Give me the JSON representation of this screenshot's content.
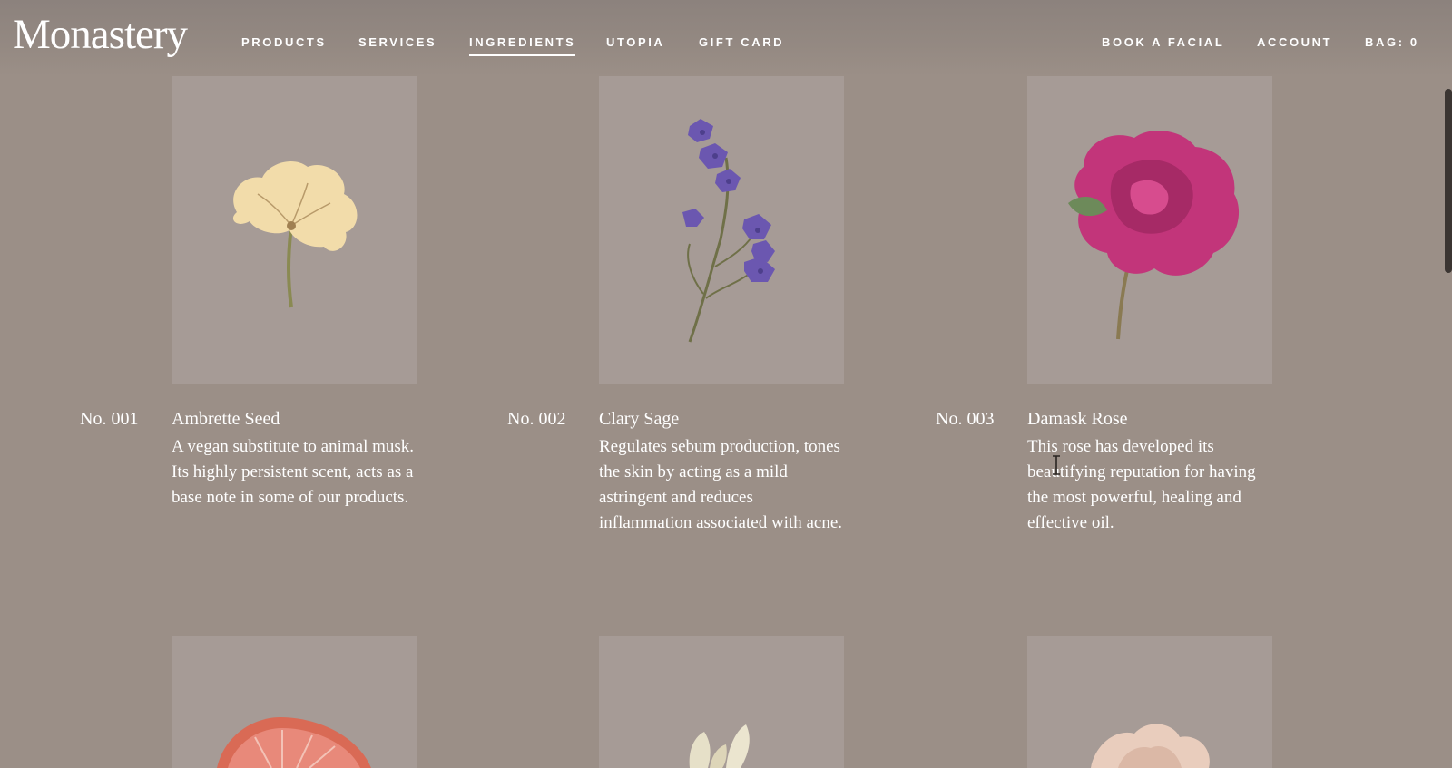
{
  "brand": {
    "logo": "Monastery"
  },
  "nav": {
    "left": [
      {
        "label": "PRODUCTS"
      },
      {
        "label": "SERVICES"
      },
      {
        "label": "INGREDIENTS"
      },
      {
        "label": "UTOPIA"
      },
      {
        "label": "GIFT CARD"
      }
    ],
    "right": [
      {
        "label": "BOOK A FACIAL"
      },
      {
        "label": "ACCOUNT"
      },
      {
        "label": "BAG: 0"
      }
    ]
  },
  "ingredients": [
    {
      "number": "No. 001",
      "name": "Ambrette Seed",
      "description": "A vegan substitute to animal musk. Its highly persistent scent, acts as a base note in some of our products.",
      "image_icon": "ambrette-flower-icon"
    },
    {
      "number": "No. 002",
      "name": "Clary Sage",
      "description": "Regulates sebum production, tones the skin by acting as a mild astringent and reduces inflammation associated with acne.",
      "image_icon": "clary-sage-flower-icon"
    },
    {
      "number": "No. 003",
      "name": "Damask Rose",
      "description": "This rose has developed its beautifying reputation for having the most powerful, healing and effective oil.",
      "image_icon": "damask-rose-icon"
    }
  ],
  "colors": {
    "background": "#9b8f87",
    "card": "#a69b96",
    "text": "#ffffff"
  }
}
